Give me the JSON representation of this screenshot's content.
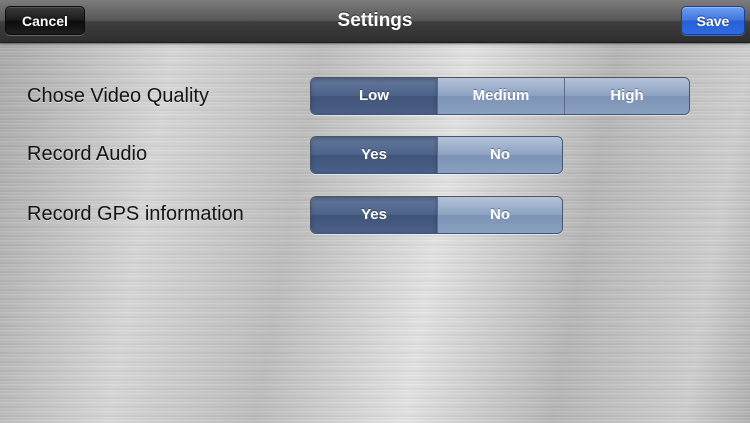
{
  "navbar": {
    "title": "Settings",
    "cancel_label": "Cancel",
    "save_label": "Save"
  },
  "settings": [
    {
      "label": "Chose Video Quality",
      "options": [
        "Low",
        "Medium",
        "High"
      ],
      "selected": "Low"
    },
    {
      "label": "Record Audio",
      "options": [
        "Yes",
        "No"
      ],
      "selected": "Yes"
    },
    {
      "label": "Record GPS information",
      "options": [
        "Yes",
        "No"
      ],
      "selected": "Yes"
    }
  ],
  "colors": {
    "nav_bar": "#3e3e3e",
    "save_accent": "#2f6ae0",
    "segment_selected": "#4c6288",
    "segment_normal": "#8ca1c1"
  }
}
